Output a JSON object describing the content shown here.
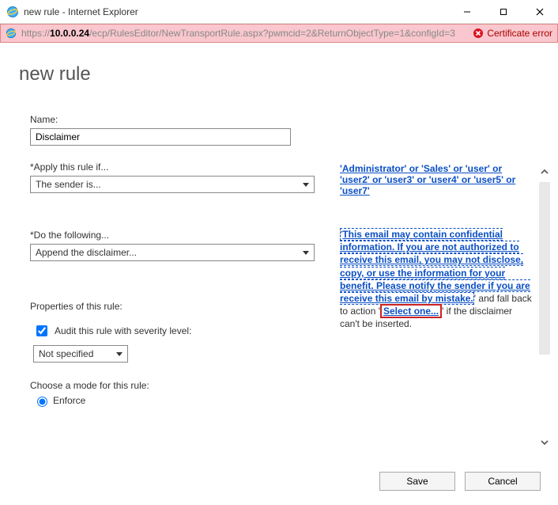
{
  "window": {
    "title": "new rule - Internet Explorer"
  },
  "url": {
    "scheme": "https://",
    "host": "10.0.0.24",
    "path": "/ecp/RulesEditor/NewTransportRule.aspx?pwmcid=2&ReturnObjectType=1&configId=3",
    "cert_error": "Certificate error"
  },
  "page": {
    "title": "new rule"
  },
  "form": {
    "name_label": "Name:",
    "name_value": "Disclaimer",
    "apply_label": "*Apply this rule if...",
    "apply_value": "The sender is...",
    "do_label": "*Do the following...",
    "do_value": "Append the disclaimer...",
    "senders_text": "'Administrator' or 'Sales' or 'user' or 'user2' or 'user3' or 'user4' or 'user5' or 'user7'",
    "disclaimer_quote_open": "'",
    "disclaimer_text": "This email may contain confidential information. If you are not authorized to receive this email, you may not disclose, copy, or use the information for your benefit. Please notify the sender if you are receive this email by mistake.",
    "fallback_pre": "' and fall back to action '",
    "select_one": "Select one...",
    "fallback_post": "' if the disclaimer can't be inserted.",
    "props_heading": "Properties of this rule:",
    "audit_label": "Audit this rule with severity level:",
    "audit_value": "Not specified",
    "mode_label": "Choose a mode for this rule:",
    "mode_enforce": "Enforce"
  },
  "footer": {
    "save": "Save",
    "cancel": "Cancel"
  }
}
